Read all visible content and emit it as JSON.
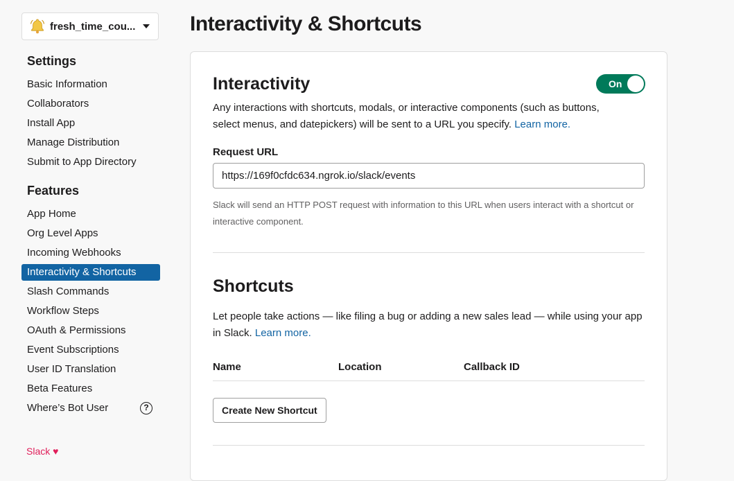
{
  "app_selector": {
    "name": "fresh_time_cou..."
  },
  "sidebar": {
    "settings_heading": "Settings",
    "settings_items": [
      {
        "label": "Basic Information"
      },
      {
        "label": "Collaborators"
      },
      {
        "label": "Install App"
      },
      {
        "label": "Manage Distribution"
      },
      {
        "label": "Submit to App Directory"
      }
    ],
    "features_heading": "Features",
    "features_items": [
      {
        "label": "App Home"
      },
      {
        "label": "Org Level Apps"
      },
      {
        "label": "Incoming Webhooks"
      },
      {
        "label": "Interactivity & Shortcuts",
        "active": true
      },
      {
        "label": "Slash Commands"
      },
      {
        "label": "Workflow Steps"
      },
      {
        "label": "OAuth & Permissions"
      },
      {
        "label": "Event Subscriptions"
      },
      {
        "label": "User ID Translation"
      },
      {
        "label": "Beta Features"
      },
      {
        "label": "Where’s Bot User"
      }
    ],
    "footer": "Slack"
  },
  "page": {
    "title": "Interactivity & Shortcuts"
  },
  "interactivity": {
    "heading": "Interactivity",
    "toggle_label": "On",
    "description": "Any interactions with shortcuts, modals, or interactive components (such as buttons, select menus, and datepickers) will be sent to a URL you specify.",
    "learn_more": "Learn more.",
    "request_url_label": "Request URL",
    "request_url_value": "https://169f0cfdc634.ngrok.io/slack/events",
    "hint": "Slack will send an HTTP POST request with information to this URL when users interact with a shortcut or interactive component."
  },
  "shortcuts": {
    "heading": "Shortcuts",
    "description": "Let people take actions — like filing a bug or adding a new sales lead — while using your app in Slack.",
    "learn_more": "Learn more.",
    "columns": [
      "Name",
      "Location",
      "Callback ID"
    ],
    "create_button": "Create New Shortcut"
  },
  "colors": {
    "accent": "#1264a3",
    "toggle_on": "#007a5a",
    "footer_heart": "#e01e5a"
  }
}
